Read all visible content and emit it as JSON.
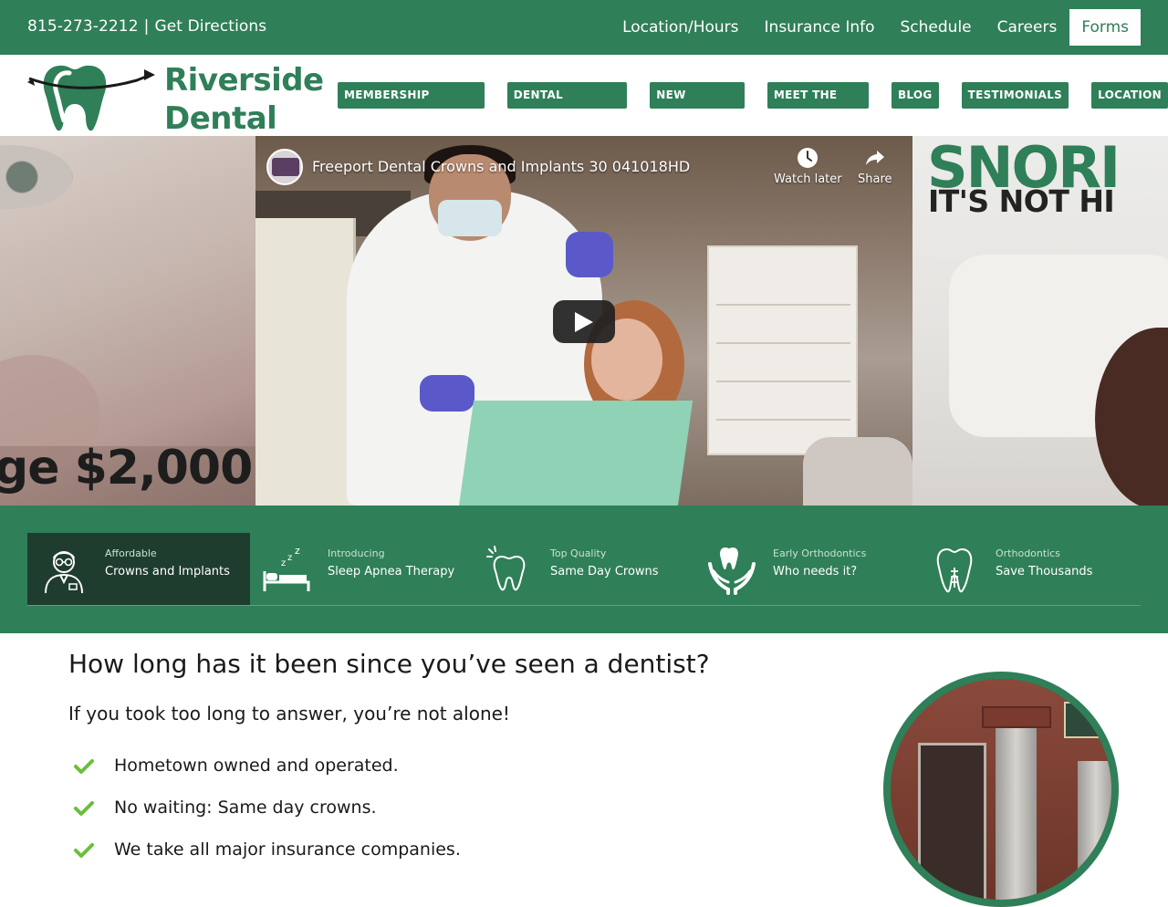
{
  "topbar": {
    "phone": "815-273-2212",
    "separator": "|",
    "directions": "Get Directions",
    "links": [
      "Location/Hours",
      "Insurance Info",
      "Schedule",
      "Careers",
      "Forms"
    ]
  },
  "header": {
    "brand_line1": "Riverside",
    "brand_line2": "Dental",
    "nav": [
      "MEMBERSHIP PROGRAM",
      "DENTAL CONCERNS",
      "NEW PATIENTS",
      "MEET THE DR'S.",
      "BLOG",
      "TESTIMONIALS",
      "LOCATION"
    ]
  },
  "hero": {
    "left_slide_text": "ge $2,000",
    "video": {
      "title": "Freeport Dental Crowns and Implants 30 041018HD",
      "watch_later": "Watch later",
      "share": "Share"
    },
    "right_slide_line1": "SNORI",
    "right_slide_line2": "IT'S NOT HI"
  },
  "features": [
    {
      "kicker": "Affordable",
      "title": "Crowns and Implants",
      "icon": "dentist-icon",
      "active": true
    },
    {
      "kicker": "Introducing",
      "title": "Sleep Apnea Therapy",
      "icon": "sleeping-bed-icon",
      "active": false
    },
    {
      "kicker": "Top Quality",
      "title": "Same Day Crowns",
      "icon": "sparkling-tooth-icon",
      "active": false
    },
    {
      "kicker": "Early Orthodontics",
      "title": "Who needs it?",
      "icon": "tooth-in-hands-icon",
      "active": false
    },
    {
      "kicker": "Orthodontics",
      "title": "Save Thousands",
      "icon": "tooth-implant-icon",
      "active": false
    }
  ],
  "content": {
    "heading": "How long has it been since you’ve seen a dentist?",
    "subheading": "If you took too long to answer, you’re not alone!",
    "bullets": [
      "Hometown owned and operated.",
      "No waiting: Same day crowns.",
      "We take all major insurance companies."
    ]
  },
  "colors": {
    "brand_green": "#2f7f58",
    "dark_green": "#1f3d2f",
    "check_green": "#6bbf3c"
  }
}
